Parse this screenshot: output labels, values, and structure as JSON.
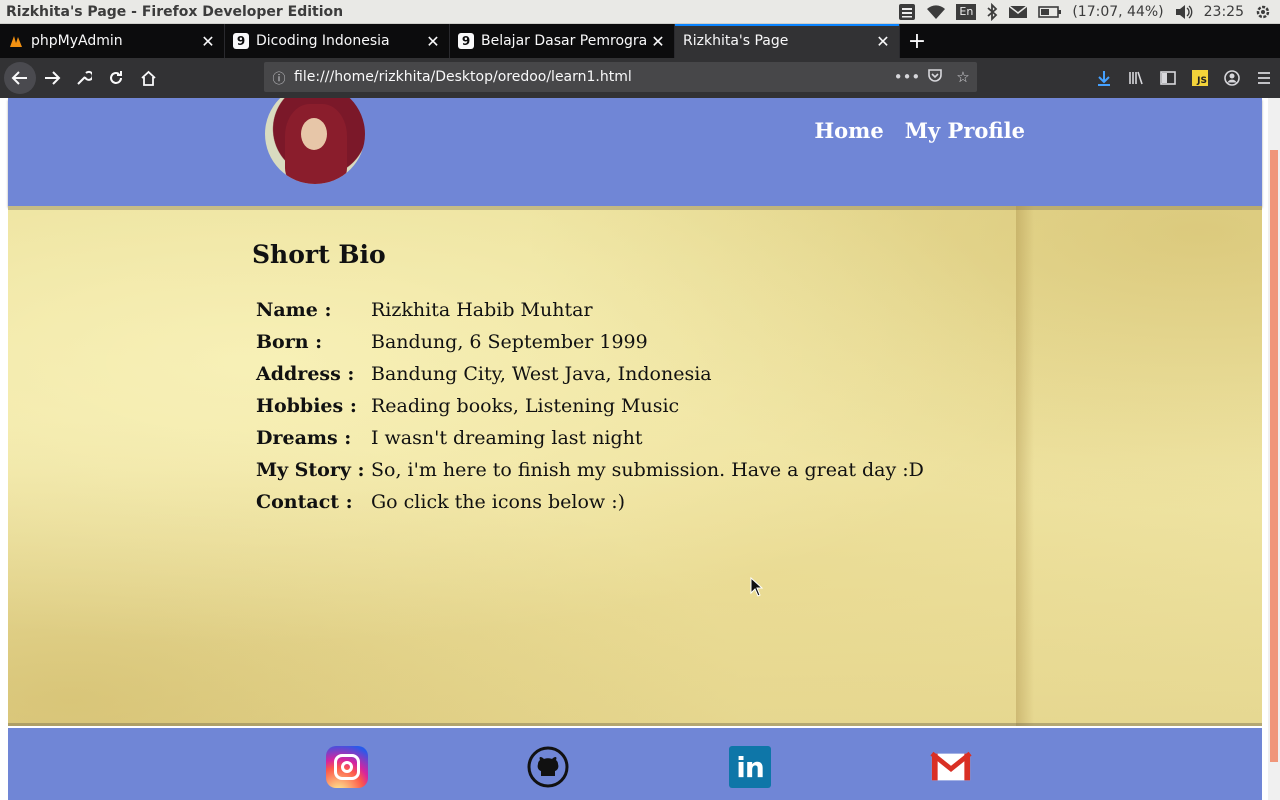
{
  "os_panel": {
    "window_title": "Rizkhita's Page - Firefox Developer Edition",
    "keyboard_layout": "En",
    "battery_text": "(17:07, 44%)",
    "clock": "23:25"
  },
  "browser": {
    "tabs": [
      {
        "label": "phpMyAdmin",
        "favicon": "phpmyadmin-icon",
        "active": false
      },
      {
        "label": "Dicoding Indonesia",
        "favicon": "dicoding-icon",
        "active": false
      },
      {
        "label": "Belajar Dasar Pemrogra",
        "favicon": "dicoding-icon",
        "active": false
      },
      {
        "label": "Rizkhita's Page",
        "favicon": "none",
        "active": true
      }
    ],
    "url": "file:///home/rizkhita/Desktop/oredoo/learn1.html",
    "accent_color": "#0a84ff"
  },
  "page": {
    "nav": {
      "home": "Home",
      "profile": "My Profile"
    },
    "bio": {
      "title": "Short Bio",
      "rows": [
        {
          "label": "Name :",
          "value": "Rizkhita Habib Muhtar"
        },
        {
          "label": "Born :",
          "value": "Bandung, 6 September 1999"
        },
        {
          "label": "Address :",
          "value": "Bandung City, West Java, Indonesia"
        },
        {
          "label": "Hobbies :",
          "value": "Reading books, Listening Music"
        },
        {
          "label": "Dreams :",
          "value": "I wasn't dreaming last night"
        },
        {
          "label": "My Story :",
          "value": "So, i'm here to finish my submission. Have a great day :D"
        },
        {
          "label": "Contact :",
          "value": "Go click the icons below :)"
        }
      ]
    },
    "social_icons": [
      "instagram-icon",
      "github-icon",
      "linkedin-icon",
      "gmail-icon"
    ],
    "header_color": "#7086d6",
    "scrollbar_color": "#f0967a"
  }
}
